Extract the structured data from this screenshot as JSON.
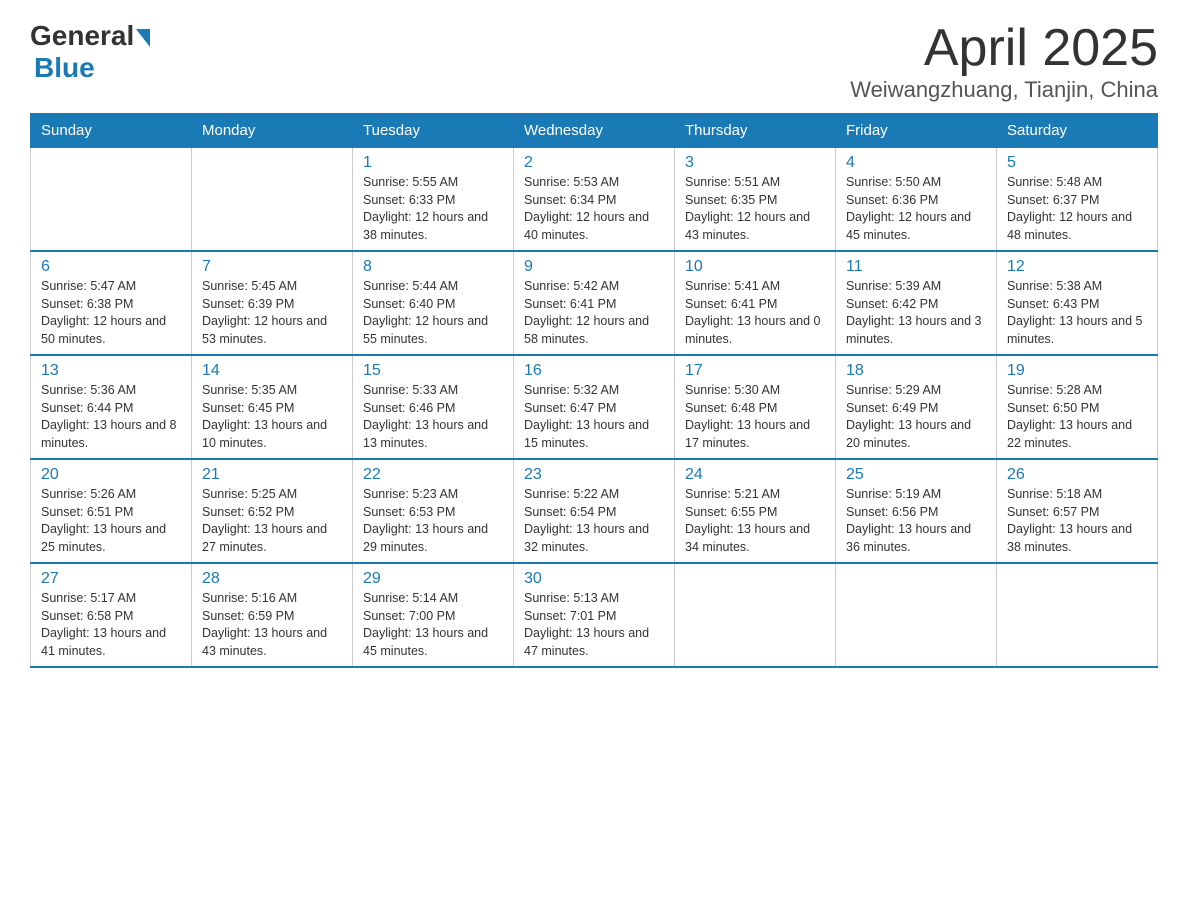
{
  "logo": {
    "general": "General",
    "blue": "Blue"
  },
  "title": "April 2025",
  "subtitle": "Weiwangzhuang, Tianjin, China",
  "days_header": [
    "Sunday",
    "Monday",
    "Tuesday",
    "Wednesday",
    "Thursday",
    "Friday",
    "Saturday"
  ],
  "weeks": [
    [
      {
        "day": "",
        "info": ""
      },
      {
        "day": "",
        "info": ""
      },
      {
        "day": "1",
        "info": "Sunrise: 5:55 AM\nSunset: 6:33 PM\nDaylight: 12 hours\nand 38 minutes."
      },
      {
        "day": "2",
        "info": "Sunrise: 5:53 AM\nSunset: 6:34 PM\nDaylight: 12 hours\nand 40 minutes."
      },
      {
        "day": "3",
        "info": "Sunrise: 5:51 AM\nSunset: 6:35 PM\nDaylight: 12 hours\nand 43 minutes."
      },
      {
        "day": "4",
        "info": "Sunrise: 5:50 AM\nSunset: 6:36 PM\nDaylight: 12 hours\nand 45 minutes."
      },
      {
        "day": "5",
        "info": "Sunrise: 5:48 AM\nSunset: 6:37 PM\nDaylight: 12 hours\nand 48 minutes."
      }
    ],
    [
      {
        "day": "6",
        "info": "Sunrise: 5:47 AM\nSunset: 6:38 PM\nDaylight: 12 hours\nand 50 minutes."
      },
      {
        "day": "7",
        "info": "Sunrise: 5:45 AM\nSunset: 6:39 PM\nDaylight: 12 hours\nand 53 minutes."
      },
      {
        "day": "8",
        "info": "Sunrise: 5:44 AM\nSunset: 6:40 PM\nDaylight: 12 hours\nand 55 minutes."
      },
      {
        "day": "9",
        "info": "Sunrise: 5:42 AM\nSunset: 6:41 PM\nDaylight: 12 hours\nand 58 minutes."
      },
      {
        "day": "10",
        "info": "Sunrise: 5:41 AM\nSunset: 6:41 PM\nDaylight: 13 hours\nand 0 minutes."
      },
      {
        "day": "11",
        "info": "Sunrise: 5:39 AM\nSunset: 6:42 PM\nDaylight: 13 hours\nand 3 minutes."
      },
      {
        "day": "12",
        "info": "Sunrise: 5:38 AM\nSunset: 6:43 PM\nDaylight: 13 hours\nand 5 minutes."
      }
    ],
    [
      {
        "day": "13",
        "info": "Sunrise: 5:36 AM\nSunset: 6:44 PM\nDaylight: 13 hours\nand 8 minutes."
      },
      {
        "day": "14",
        "info": "Sunrise: 5:35 AM\nSunset: 6:45 PM\nDaylight: 13 hours\nand 10 minutes."
      },
      {
        "day": "15",
        "info": "Sunrise: 5:33 AM\nSunset: 6:46 PM\nDaylight: 13 hours\nand 13 minutes."
      },
      {
        "day": "16",
        "info": "Sunrise: 5:32 AM\nSunset: 6:47 PM\nDaylight: 13 hours\nand 15 minutes."
      },
      {
        "day": "17",
        "info": "Sunrise: 5:30 AM\nSunset: 6:48 PM\nDaylight: 13 hours\nand 17 minutes."
      },
      {
        "day": "18",
        "info": "Sunrise: 5:29 AM\nSunset: 6:49 PM\nDaylight: 13 hours\nand 20 minutes."
      },
      {
        "day": "19",
        "info": "Sunrise: 5:28 AM\nSunset: 6:50 PM\nDaylight: 13 hours\nand 22 minutes."
      }
    ],
    [
      {
        "day": "20",
        "info": "Sunrise: 5:26 AM\nSunset: 6:51 PM\nDaylight: 13 hours\nand 25 minutes."
      },
      {
        "day": "21",
        "info": "Sunrise: 5:25 AM\nSunset: 6:52 PM\nDaylight: 13 hours\nand 27 minutes."
      },
      {
        "day": "22",
        "info": "Sunrise: 5:23 AM\nSunset: 6:53 PM\nDaylight: 13 hours\nand 29 minutes."
      },
      {
        "day": "23",
        "info": "Sunrise: 5:22 AM\nSunset: 6:54 PM\nDaylight: 13 hours\nand 32 minutes."
      },
      {
        "day": "24",
        "info": "Sunrise: 5:21 AM\nSunset: 6:55 PM\nDaylight: 13 hours\nand 34 minutes."
      },
      {
        "day": "25",
        "info": "Sunrise: 5:19 AM\nSunset: 6:56 PM\nDaylight: 13 hours\nand 36 minutes."
      },
      {
        "day": "26",
        "info": "Sunrise: 5:18 AM\nSunset: 6:57 PM\nDaylight: 13 hours\nand 38 minutes."
      }
    ],
    [
      {
        "day": "27",
        "info": "Sunrise: 5:17 AM\nSunset: 6:58 PM\nDaylight: 13 hours\nand 41 minutes."
      },
      {
        "day": "28",
        "info": "Sunrise: 5:16 AM\nSunset: 6:59 PM\nDaylight: 13 hours\nand 43 minutes."
      },
      {
        "day": "29",
        "info": "Sunrise: 5:14 AM\nSunset: 7:00 PM\nDaylight: 13 hours\nand 45 minutes."
      },
      {
        "day": "30",
        "info": "Sunrise: 5:13 AM\nSunset: 7:01 PM\nDaylight: 13 hours\nand 47 minutes."
      },
      {
        "day": "",
        "info": ""
      },
      {
        "day": "",
        "info": ""
      },
      {
        "day": "",
        "info": ""
      }
    ]
  ]
}
